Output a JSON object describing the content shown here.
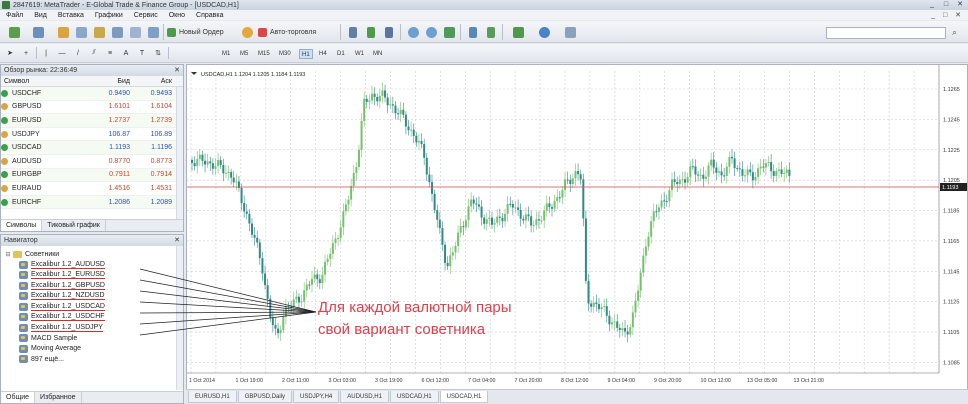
{
  "window": {
    "title": "2847619: MetaTrader - E-Global Trade & Finance Group - [USDCAD,H1]",
    "controls": [
      "_",
      "□",
      "✕"
    ]
  },
  "menu": {
    "items": [
      "Файл",
      "Вид",
      "Вставка",
      "Графики",
      "Сервис",
      "Окно",
      "Справка"
    ],
    "mdi_controls": "_ □ ✕"
  },
  "toolbar": {
    "new_order": "Новый Ордер",
    "autotrading": "Авто-торговля",
    "timeframes": [
      "M1",
      "M5",
      "M15",
      "M30",
      "H1",
      "H4",
      "D1",
      "W1",
      "MN"
    ],
    "search_placeholder": ""
  },
  "market_watch": {
    "title": "Обзор рынка: 22:36:49",
    "columns": [
      "Символ",
      "Бид",
      "Аск"
    ],
    "rows": [
      {
        "symbol": "USDCHF",
        "bid": "0.9490",
        "ask": "0.9493",
        "color": "#2b4fbf"
      },
      {
        "symbol": "GBPUSD",
        "bid": "1.6101",
        "ask": "1.6104",
        "color": "#c8452b"
      },
      {
        "symbol": "EURUSD",
        "bid": "1.2737",
        "ask": "1.2739",
        "color": "#c8452b"
      },
      {
        "symbol": "USDJPY",
        "bid": "106.87",
        "ask": "106.89",
        "color": "#2b4fbf"
      },
      {
        "symbol": "USDCAD",
        "bid": "1.1193",
        "ask": "1.1196",
        "color": "#2b4fbf"
      },
      {
        "symbol": "AUDUSD",
        "bid": "0.8770",
        "ask": "0.8773",
        "color": "#c8452b"
      },
      {
        "symbol": "EURGBP",
        "bid": "0.7911",
        "ask": "0.7914",
        "color": "#c8452b"
      },
      {
        "symbol": "EURAUD",
        "bid": "1.4516",
        "ask": "1.4531",
        "color": "#c8452b"
      },
      {
        "symbol": "EURCHF",
        "bid": "1.2086",
        "ask": "1.2089",
        "color": "#2b4fbf"
      }
    ],
    "tabs": [
      "Символы",
      "Тиковый график"
    ]
  },
  "navigator": {
    "title": "Навигатор",
    "root": "Советники",
    "experts": [
      "Excalibur 1.2_AUDUSD",
      "Excalibur 1.2_EURUSD",
      "Excalibur 1.2_GBPUSD",
      "Excalibur 1.2_NZDUSD",
      "Excalibur 1.2_USDCAD",
      "Excalibur 1.2_USDCHF",
      "Excalibur 1.2_USDJPY"
    ],
    "other": [
      "MACD Sample",
      "Moving Average",
      "897 ещё..."
    ],
    "tabs": [
      "Общие",
      "Избранное"
    ]
  },
  "chart": {
    "header": "USDCAD,H1  1.1204 1.1205 1.1184 1.1193",
    "price_labels": [
      "1.1265",
      "1.1245",
      "1.1225",
      "1.1205",
      "1.1185",
      "1.1165",
      "1.1145",
      "1.1125",
      "1.1105",
      "1.1085"
    ],
    "current_price": "1.1193",
    "time_labels": [
      "1 Oct 2014",
      "1 Oct 19:00",
      "2 Oct 11:00",
      "3 Oct 03:00",
      "3 Oct 19:00",
      "6 Oct 12:00",
      "7 Oct 04:00",
      "7 Oct 20:00",
      "8 Oct 12:00",
      "9 Oct 04:00",
      "9 Oct 20:00",
      "10 Oct 12:00",
      "13 Oct 05:00",
      "13 Oct 21:00"
    ],
    "annotation_line1": "Для каждой валютной пары",
    "annotation_line2": "свой вариант советника",
    "bull_color": "#74c26b",
    "bear_color": "#2f8a88",
    "price_line_color": "#d94848"
  },
  "chart_tabs": [
    "EURUSD,H1",
    "GBPUSD,Daily",
    "USDJPY,H4",
    "AUDUSD,H1",
    "USDCAD,H1",
    "USDCAD,H1"
  ]
}
